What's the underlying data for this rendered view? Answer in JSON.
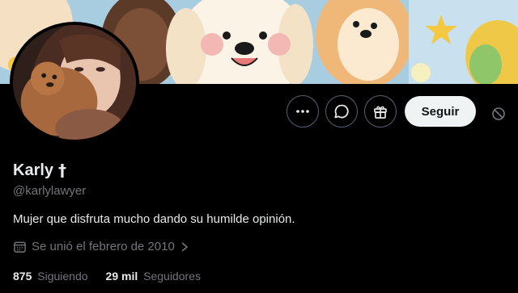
{
  "profile": {
    "name": "Karly",
    "name_glyph": "†",
    "handle": "@karlylawyer",
    "bio": "Mujer que disfruta mucho dando su humilde opinión.",
    "joined": "Se unió el febrero de 2010",
    "following_count": "875",
    "following_label": "Siguiendo",
    "followers_count": "29 mil",
    "followers_label": "Seguidores"
  },
  "actions": {
    "more_icon": "more-icon",
    "message_icon": "message-icon",
    "gift_icon": "gift-icon",
    "follow_label": "Seguir",
    "block_icon": "block-icon"
  },
  "colors": {
    "background": "#000000",
    "text_primary": "#e7e9ea",
    "text_secondary": "#71767b",
    "button_border": "#536471",
    "follow_bg": "#eff3f4"
  }
}
